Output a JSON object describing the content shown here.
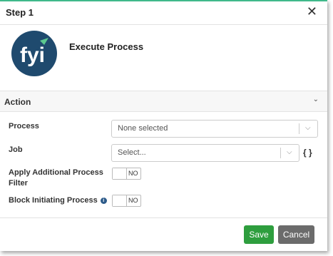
{
  "dialog": {
    "title": "Step 1",
    "close_icon": "close-icon",
    "app_title": "Execute Process",
    "logo_text": "fyi",
    "accent_color": "#3fb98a",
    "logo_color": "#1f4a6e"
  },
  "section": {
    "title": "Action",
    "icon": "chevron-down-icon"
  },
  "fields": {
    "process_label": "Process",
    "process_value": "None selected",
    "job_label": "Job",
    "job_placeholder": "Select...",
    "job_icon": "braces-icon",
    "apply_filter_label_line1": "Apply Additional Process",
    "apply_filter_label_line2": "Filter",
    "apply_filter_value": "NO",
    "block_label": "Block Initiating Process",
    "block_info_icon": "info-icon",
    "block_value": "NO"
  },
  "footer": {
    "save_label": "Save",
    "cancel_label": "Cancel",
    "save_color": "#2e9e3e",
    "cancel_color": "#6b6b6b"
  }
}
